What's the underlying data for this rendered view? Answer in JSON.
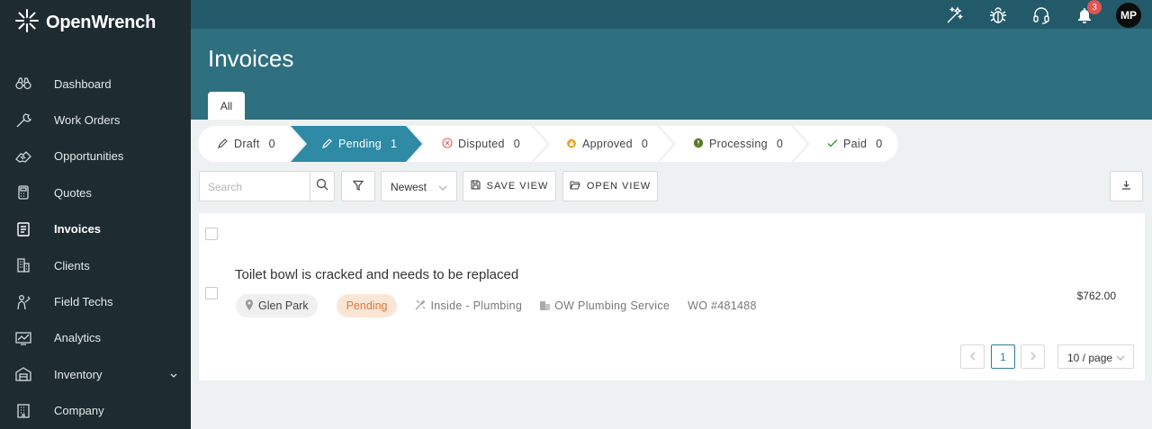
{
  "brand": {
    "name": "OpenWrench"
  },
  "sidebar": {
    "items": [
      {
        "label": "Dashboard",
        "icon": "binoculars-icon"
      },
      {
        "label": "Work Orders",
        "icon": "wrench-icon"
      },
      {
        "label": "Opportunities",
        "icon": "handshake-icon"
      },
      {
        "label": "Quotes",
        "icon": "calculator-icon"
      },
      {
        "label": "Invoices",
        "icon": "invoice-icon",
        "active": true
      },
      {
        "label": "Clients",
        "icon": "buildings-icon"
      },
      {
        "label": "Field Techs",
        "icon": "technician-icon"
      },
      {
        "label": "Analytics",
        "icon": "chart-icon"
      },
      {
        "label": "Inventory",
        "icon": "warehouse-icon",
        "has_submenu": true
      },
      {
        "label": "Company",
        "icon": "company-icon"
      }
    ]
  },
  "topbar": {
    "notifications_count": "3",
    "avatar_initials": "MP"
  },
  "page": {
    "title": "Invoices",
    "tab_all": "All"
  },
  "steps": [
    {
      "label": "Draft",
      "count": "0"
    },
    {
      "label": "Pending",
      "count": "1",
      "active": true
    },
    {
      "label": "Disputed",
      "count": "0"
    },
    {
      "label": "Approved",
      "count": "0"
    },
    {
      "label": "Processing",
      "count": "0"
    },
    {
      "label": "Paid",
      "count": "0"
    }
  ],
  "toolbar": {
    "search_placeholder": "Search",
    "sort_value": "Newest",
    "save_view_label": "SAVE VIEW",
    "open_view_label": "OPEN VIEW"
  },
  "invoice": {
    "title": "Toilet bowl is cracked and needs to be replaced",
    "location": "Glen Park",
    "status": "Pending",
    "trade": "Inside - Plumbing",
    "vendor": "OW Plumbing Service",
    "work_order": "WO #481488",
    "amount": "$762.00"
  },
  "pagination": {
    "current_page": "1",
    "page_size": "10 / page"
  },
  "colors": {
    "sidebar_bg": "#1e2b31",
    "topbar_bg": "#235a69",
    "header_bg": "#2e6f80",
    "active_step": "#2e8aa5",
    "pending_chip_bg": "#fbe6d6",
    "pending_chip_text": "#d9773a"
  }
}
